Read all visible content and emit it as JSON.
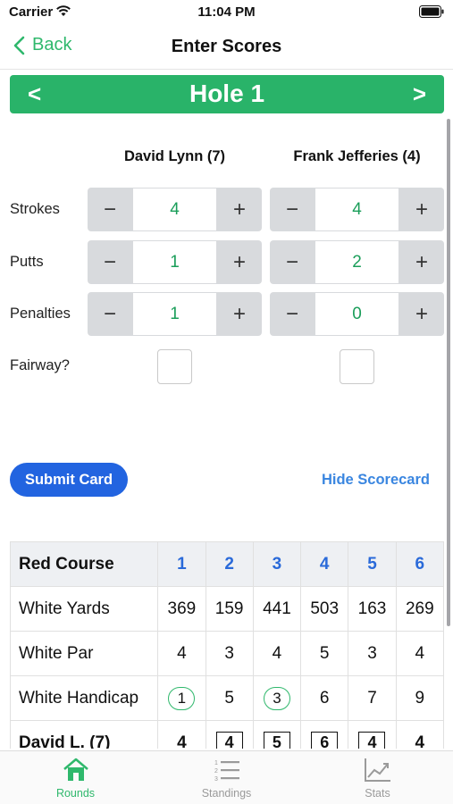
{
  "status_bar": {
    "carrier": "Carrier",
    "time": "11:04 PM"
  },
  "nav": {
    "back_label": "Back",
    "title": "Enter Scores"
  },
  "hole": {
    "prev": "<",
    "title": "Hole 1",
    "next": ">"
  },
  "players": [
    {
      "name": "David Lynn (7)",
      "strokes": "4",
      "putts": "1",
      "penalties": "1",
      "fairway": false
    },
    {
      "name": "Frank Jefferies (4)",
      "strokes": "4",
      "putts": "2",
      "penalties": "0",
      "fairway": false
    }
  ],
  "labels": {
    "strokes": "Strokes",
    "putts": "Putts",
    "penalties": "Penalties",
    "fairway": "Fairway?",
    "minus": "−",
    "plus": "+"
  },
  "actions": {
    "submit": "Submit Card",
    "hide_scorecard": "Hide Scorecard"
  },
  "scorecard": {
    "course": "Red Course",
    "holes": [
      "1",
      "2",
      "3",
      "4",
      "5",
      "6"
    ],
    "rows": [
      {
        "label": "White Yards",
        "values": [
          "369",
          "159",
          "441",
          "503",
          "163",
          "269"
        ]
      },
      {
        "label": "White Par",
        "values": [
          "4",
          "3",
          "4",
          "5",
          "3",
          "4"
        ]
      },
      {
        "label": "White Handicap",
        "values": [
          "1",
          "5",
          "3",
          "6",
          "7",
          "9"
        ]
      }
    ],
    "player_row": {
      "label": "David L. (7)",
      "values": [
        "4",
        "4",
        "5",
        "6",
        "4",
        "4"
      ]
    }
  },
  "tabs": [
    {
      "label": "Rounds",
      "icon": "home-icon",
      "active": true
    },
    {
      "label": "Standings",
      "icon": "list-icon",
      "active": false
    },
    {
      "label": "Stats",
      "icon": "chart-icon",
      "active": false
    }
  ],
  "colors": {
    "accent": "#29b369",
    "link": "#3a86e0",
    "primary_button": "#2264e0",
    "header_blue": "#2a6ad9"
  }
}
